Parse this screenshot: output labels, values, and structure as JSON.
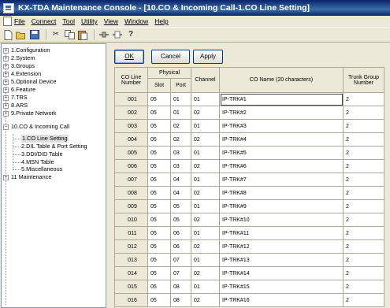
{
  "window": {
    "title": "KX-TDA Maintenance Console - [10.CO & Incoming Call-1.CO Line Setting]"
  },
  "menu": [
    {
      "label": "File"
    },
    {
      "label": "Connect"
    },
    {
      "label": "Tool"
    },
    {
      "label": "Utility"
    },
    {
      "label": "View"
    },
    {
      "label": "Window"
    },
    {
      "label": "Help"
    }
  ],
  "toolbar": {
    "icons": [
      "new-icon",
      "open-icon",
      "save-icon",
      "cut-icon",
      "copy-icon",
      "paste-icon",
      "connect-icon",
      "disconnect-icon",
      "help-icon"
    ]
  },
  "tree": [
    {
      "label": "1.Configuration",
      "expander": "+"
    },
    {
      "label": "2.System",
      "expander": "+"
    },
    {
      "label": "3.Groups",
      "expander": "+"
    },
    {
      "label": "4.Extension",
      "expander": "+"
    },
    {
      "label": "5.Optional Device",
      "expander": "+"
    },
    {
      "label": "6.Feature",
      "expander": "+"
    },
    {
      "label": "7.TRS",
      "expander": "+"
    },
    {
      "label": "8.ARS",
      "expander": "+"
    },
    {
      "label": "9.Private Network",
      "expander": "+"
    },
    {
      "label": "10.CO & Incoming Call",
      "expander": "−"
    },
    {
      "label": "1.CO Line Setting",
      "child": true,
      "selected": true
    },
    {
      "label": "2.DIL Table & Port Setting",
      "child": true
    },
    {
      "label": "3.DDI/DID Table",
      "child": true
    },
    {
      "label": "4.MSN Table",
      "child": true
    },
    {
      "label": "5.Miscellaneous",
      "child": true
    },
    {
      "label": "11 Maintenance",
      "expander": "+"
    }
  ],
  "buttons": {
    "ok": "OK",
    "cancel": "Cancel",
    "apply": "Apply"
  },
  "table": {
    "headers": {
      "co_line_number": "CO Line Number",
      "physical": "Physical",
      "slot": "Slot",
      "port": "Port",
      "channel": "Channel",
      "co_name": "CO Name (20 characters)",
      "trunk_group_number": "Trunk Group Number"
    },
    "rows": [
      {
        "co": "001",
        "slot": "05",
        "port": "01",
        "channel": "01",
        "name": "IP-TRK#1",
        "trunk": "2"
      },
      {
        "co": "002",
        "slot": "05",
        "port": "01",
        "channel": "02",
        "name": "IP-TRK#2",
        "trunk": "2"
      },
      {
        "co": "003",
        "slot": "05",
        "port": "02",
        "channel": "01",
        "name": "IP-TRK#3",
        "trunk": "2"
      },
      {
        "co": "004",
        "slot": "05",
        "port": "02",
        "channel": "02",
        "name": "IP-TRK#4",
        "trunk": "2"
      },
      {
        "co": "005",
        "slot": "05",
        "port": "03",
        "channel": "01",
        "name": "IP-TRK#5",
        "trunk": "2"
      },
      {
        "co": "006",
        "slot": "05",
        "port": "03",
        "channel": "02",
        "name": "IP-TRK#6",
        "trunk": "2"
      },
      {
        "co": "007",
        "slot": "05",
        "port": "04",
        "channel": "01",
        "name": "IP-TRK#7",
        "trunk": "2"
      },
      {
        "co": "008",
        "slot": "05",
        "port": "04",
        "channel": "02",
        "name": "IP-TRK#8",
        "trunk": "2"
      },
      {
        "co": "009",
        "slot": "05",
        "port": "05",
        "channel": "01",
        "name": "IP-TRK#9",
        "trunk": "2"
      },
      {
        "co": "010",
        "slot": "05",
        "port": "05",
        "channel": "02",
        "name": "IP-TRK#10",
        "trunk": "2"
      },
      {
        "co": "011",
        "slot": "05",
        "port": "06",
        "channel": "01",
        "name": "IP-TRK#11",
        "trunk": "2"
      },
      {
        "co": "012",
        "slot": "05",
        "port": "06",
        "channel": "02",
        "name": "IP-TRK#12",
        "trunk": "2"
      },
      {
        "co": "013",
        "slot": "05",
        "port": "07",
        "channel": "01",
        "name": "IP-TRK#13",
        "trunk": "2"
      },
      {
        "co": "014",
        "slot": "05",
        "port": "07",
        "channel": "02",
        "name": "IP-TRK#14",
        "trunk": "2"
      },
      {
        "co": "015",
        "slot": "05",
        "port": "08",
        "channel": "01",
        "name": "IP-TRK#15",
        "trunk": "2"
      },
      {
        "co": "016",
        "slot": "05",
        "port": "08",
        "channel": "02",
        "name": "IP-TRK#16",
        "trunk": "2"
      }
    ]
  }
}
